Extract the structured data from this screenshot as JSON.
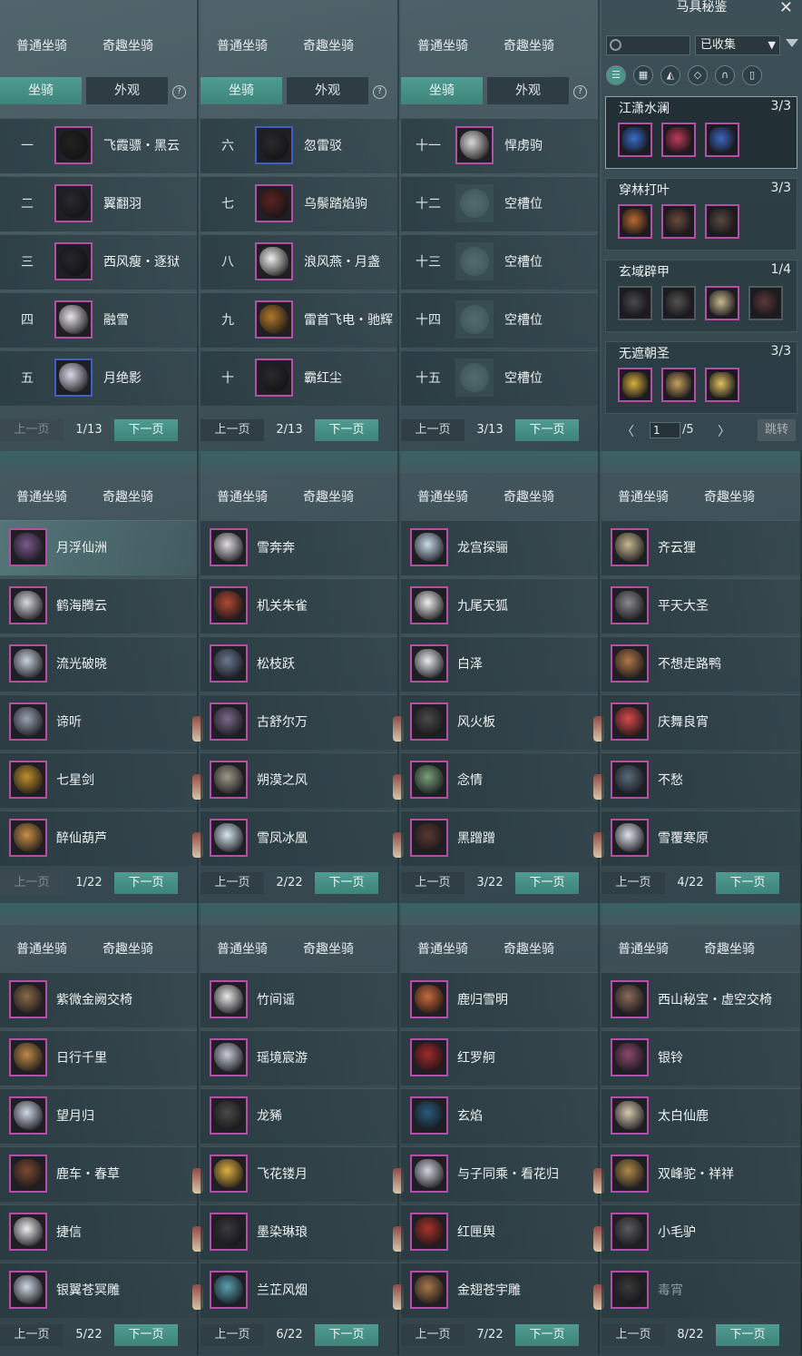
{
  "window_title": "马具秘鉴",
  "tab_normal": "普通坐骑",
  "tab_fun": "奇趣坐骑",
  "seg_mount": "坐骑",
  "seg_look": "外观",
  "help": "?",
  "prev": "上一页",
  "next": "下一页",
  "accent_color": "#4a948a",
  "quality_purple": "#b44fa5",
  "quality_blue": "#3d5fc7",
  "top_panels": [
    {
      "page": "1/13",
      "prev_disabled": true,
      "rows": [
        {
          "num": "一",
          "name": "飞霞骠・黑云",
          "q": "purple",
          "c": "#222"
        },
        {
          "num": "二",
          "name": "翼翻羽",
          "q": "purple",
          "c": "#2a2a2e"
        },
        {
          "num": "三",
          "name": "西风瘦・逐狱",
          "q": "purple",
          "c": "#26262b"
        },
        {
          "num": "四",
          "name": "融雪",
          "q": "purple",
          "c": "#e9e4ea"
        },
        {
          "num": "五",
          "name": "月绝影",
          "q": "blue",
          "c": "#dcd8ea"
        }
      ]
    },
    {
      "page": "2/13",
      "prev_disabled": false,
      "rows": [
        {
          "num": "六",
          "name": "忽雷驳",
          "q": "blue",
          "c": "#2a2a2e"
        },
        {
          "num": "七",
          "name": "乌鬃踏焰驹",
          "q": "purple",
          "c": "#5a2422"
        },
        {
          "num": "八",
          "name": "浪风燕・月盏",
          "q": "purple",
          "c": "#eeeeee"
        },
        {
          "num": "九",
          "name": "雷首飞电・驰辉",
          "q": "purple",
          "c": "#b0782e"
        },
        {
          "num": "十",
          "name": "霸红尘",
          "q": "purple",
          "c": "#2a2a2e"
        }
      ]
    },
    {
      "page": "3/13",
      "prev_disabled": false,
      "rows": [
        {
          "num": "十一",
          "name": "悍虏驹",
          "q": "purple",
          "c": "#d9d9d9"
        },
        {
          "num": "十二",
          "name": "空槽位",
          "q": "empty",
          "c": ""
        },
        {
          "num": "十三",
          "name": "空槽位",
          "q": "empty",
          "c": ""
        },
        {
          "num": "十四",
          "name": "空槽位",
          "q": "empty",
          "c": ""
        },
        {
          "num": "十五",
          "name": "空槽位",
          "q": "empty",
          "c": ""
        }
      ]
    }
  ],
  "collection": {
    "search_placeholder": "",
    "filter_value": "已收集",
    "filter_icons": [
      "list-icon",
      "grid-icon",
      "saddle-icon",
      "armor-icon",
      "horseshoe-icon",
      "stirrup-icon"
    ],
    "sets": [
      {
        "name": "江潇水澜",
        "count": "3/3",
        "items": [
          "#3a6fc7",
          "#c03a5a",
          "#3c68c0"
        ]
      },
      {
        "name": "穿林打叶",
        "count": "3/3",
        "items": [
          "#b86a32",
          "#6a4a3a",
          "#5a4a40"
        ]
      },
      {
        "name": "玄域辟甲",
        "count": "1/4",
        "items": [
          "#4a4a4a",
          "#55524e",
          "#c8b890",
          "#5a3a3a"
        ]
      },
      {
        "name": "无遮朝圣",
        "count": "3/3",
        "items": [
          "#d8b040",
          "#c8a060",
          "#e0c060"
        ]
      }
    ],
    "page_input": "1",
    "page_total": "/5",
    "jump": "跳转",
    "prev_arrow": "〈",
    "next_arrow": "〉"
  },
  "fun_panels": [
    {
      "page": "1/22",
      "prev_disabled": true,
      "rows": [
        {
          "name": "月浮仙洲",
          "c": "#7a5a8a",
          "sel": true
        },
        {
          "name": "鹤海腾云",
          "c": "#d8d8e0"
        },
        {
          "name": "流光破晓",
          "c": "#c9d2dc"
        },
        {
          "name": "谛听",
          "c": "#9aa4b4"
        },
        {
          "name": "七星剑",
          "c": "#c0902e"
        },
        {
          "name": "醉仙葫芦",
          "c": "#c89048"
        }
      ]
    },
    {
      "page": "2/22",
      "prev_disabled": false,
      "rows": [
        {
          "name": "雪奔奔",
          "c": "#e0dde0"
        },
        {
          "name": "机关朱雀",
          "c": "#b04a32"
        },
        {
          "name": "松枝跃",
          "c": "#6a7890"
        },
        {
          "name": "古舒尔万",
          "c": "#7a6a8a"
        },
        {
          "name": "朔漠之风",
          "c": "#a0988a"
        },
        {
          "name": "雪凤冰凰",
          "c": "#d6e6f0"
        }
      ]
    },
    {
      "page": "3/22",
      "prev_disabled": false,
      "rows": [
        {
          "name": "龙宫探骊",
          "c": "#c8dcea"
        },
        {
          "name": "九尾天狐",
          "c": "#eeeeee"
        },
        {
          "name": "白泽",
          "c": "#e8eaec"
        },
        {
          "name": "风火板",
          "c": "#4a4a4a"
        },
        {
          "name": "念情",
          "c": "#7aa07a"
        },
        {
          "name": "黑蹭蹭",
          "c": "#5a3a32"
        }
      ]
    },
    {
      "page": "4/22",
      "prev_disabled": false,
      "rows": [
        {
          "name": "齐云狸",
          "c": "#c8b890"
        },
        {
          "name": "平天大圣",
          "c": "#8a8a90"
        },
        {
          "name": "不想走路鸭",
          "c": "#b07848"
        },
        {
          "name": "庆舞良宵",
          "c": "#d84a4a"
        },
        {
          "name": "不愁",
          "c": "#5a6a7a"
        },
        {
          "name": "雪覆寒原",
          "c": "#dde2ea"
        }
      ]
    },
    {
      "page": "5/22",
      "prev_disabled": false,
      "rows": [
        {
          "name": "紫微金阙交椅",
          "c": "#8a6a4a"
        },
        {
          "name": "日行千里",
          "c": "#c08a4a"
        },
        {
          "name": "望月归",
          "c": "#d0d8e8"
        },
        {
          "name": "鹿车・春草",
          "c": "#7a4a32"
        },
        {
          "name": "捷信",
          "c": "#eeeeee"
        },
        {
          "name": "银翼苍冥雕",
          "c": "#d0d8e4"
        }
      ]
    },
    {
      "page": "6/22",
      "prev_disabled": false,
      "rows": [
        {
          "name": "竹间谣",
          "c": "#e8e8e8"
        },
        {
          "name": "瑶境宸游",
          "c": "#c8ccd8"
        },
        {
          "name": "龙豨",
          "c": "#4a4a48"
        },
        {
          "name": "飞花镂月",
          "c": "#e0b040"
        },
        {
          "name": "墨染琳琅",
          "c": "#3a3a3e"
        },
        {
          "name": "兰芷风烟",
          "c": "#5aa0b0"
        }
      ]
    },
    {
      "page": "7/22",
      "prev_disabled": false,
      "rows": [
        {
          "name": "鹿归雪明",
          "c": "#c86a3a"
        },
        {
          "name": "红罗舸",
          "c": "#a02a2a"
        },
        {
          "name": "玄焰",
          "c": "#2a5a7a"
        },
        {
          "name": "与子同乘・看花归",
          "c": "#d0d4dc"
        },
        {
          "name": "红匣舆",
          "c": "#a8322a"
        },
        {
          "name": "金翅苍宇雕",
          "c": "#a8784a"
        }
      ]
    },
    {
      "page": "8/22",
      "prev_disabled": false,
      "rows": [
        {
          "name": "西山秘宝・虚空交椅",
          "c": "#8a6a5a"
        },
        {
          "name": "银铃",
          "c": "#8a4a6a"
        },
        {
          "name": "太白仙鹿",
          "c": "#d8c8b0"
        },
        {
          "name": "双峰驼・祥祥",
          "c": "#b08a4a"
        },
        {
          "name": "小毛驴",
          "c": "#5a5a60"
        },
        {
          "name": "毒宵",
          "c": "#3a3a3a",
          "dim": true
        }
      ]
    }
  ]
}
